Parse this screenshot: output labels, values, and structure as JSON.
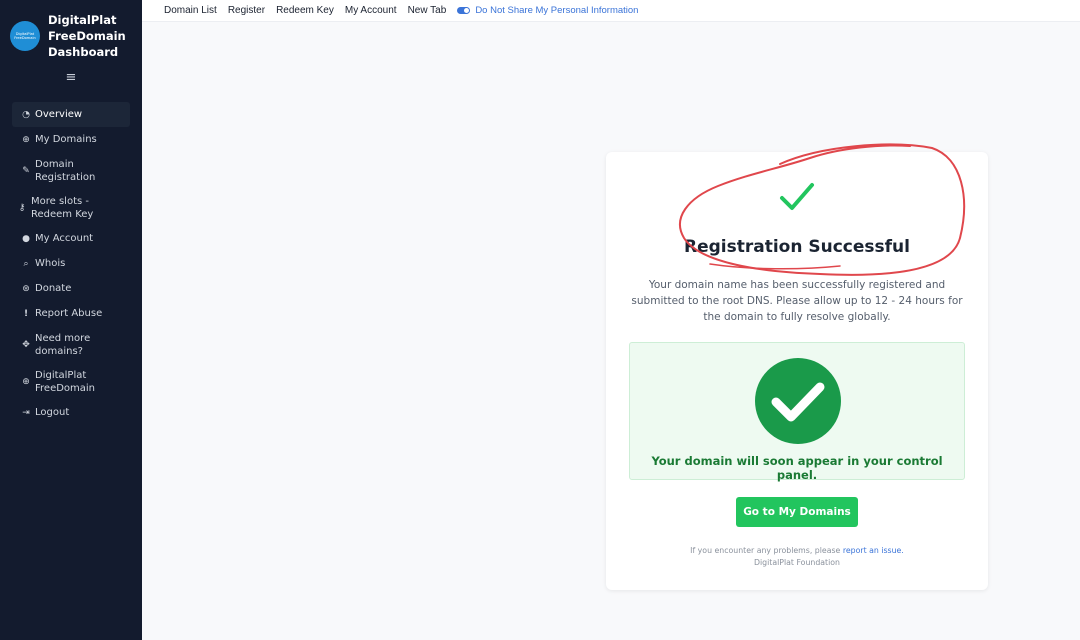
{
  "brand": {
    "logo_line1": "DigitalPlat",
    "logo_line2": "FreeDomain",
    "title": "DigitalPlat FreeDomain Dashboard"
  },
  "menu_toggle": "≡",
  "sidebar": {
    "items": [
      {
        "label": "Overview",
        "icon": "dashboard-icon",
        "glyph": "◔",
        "active": true
      },
      {
        "label": "My Domains",
        "icon": "globe-icon",
        "glyph": "⊕"
      },
      {
        "label": "Domain Registration",
        "icon": "edit-icon",
        "glyph": "✎"
      },
      {
        "label": "More slots - Redeem Key",
        "icon": "key-icon",
        "glyph": "⚷"
      },
      {
        "label": "My Account",
        "icon": "user-icon",
        "glyph": "●"
      },
      {
        "label": "Whois",
        "icon": "search-icon",
        "glyph": "⌕"
      },
      {
        "label": "Donate",
        "icon": "donate-icon",
        "glyph": "⊛"
      },
      {
        "label": "Report Abuse",
        "icon": "exclamation-icon",
        "glyph": "!"
      },
      {
        "label": "Need more domains?",
        "icon": "arrows-icon",
        "glyph": "✥"
      },
      {
        "label": "DigitalPlat FreeDomain",
        "icon": "globe-icon",
        "glyph": "⊕"
      },
      {
        "label": "Logout",
        "icon": "logout-icon",
        "glyph": "⇥"
      }
    ]
  },
  "topbar": {
    "links": [
      "Domain List",
      "Register",
      "Redeem Key",
      "My Account",
      "New Tab"
    ],
    "privacy": "Do Not Share My Personal Information"
  },
  "card": {
    "title": "Registration Successful",
    "description": "Your domain name has been successfully registered and submitted to the root DNS. Please allow up to 12 - 24 hours for the domain to fully resolve globally.",
    "success_message": "Your domain will soon appear in your control panel.",
    "button": "Go to My Domains",
    "footer_text": "If you encounter any problems, please",
    "footer_link": "report an issue.",
    "footer_org": "DigitalPlat Foundation"
  },
  "colors": {
    "sidebar_bg": "#131b2e",
    "success_green": "#22c55e",
    "dark_green": "#1a9a4a",
    "link_blue": "#3b74d8",
    "annotation_red": "#e0474c"
  }
}
